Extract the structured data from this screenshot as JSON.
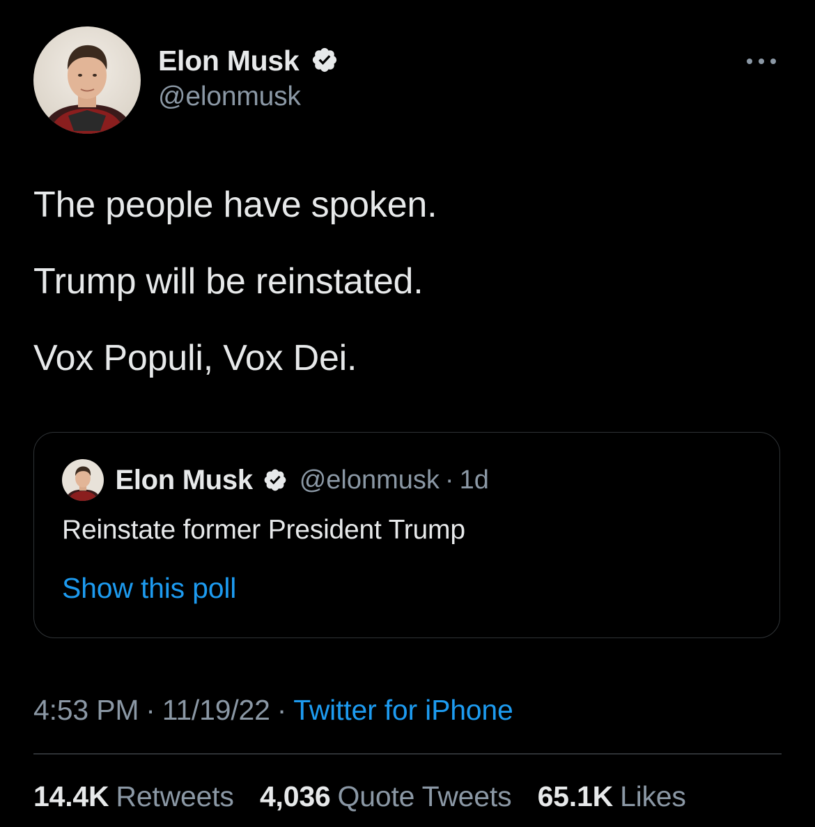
{
  "author": {
    "display_name": "Elon Musk",
    "handle": "@elonmusk",
    "verified": true
  },
  "tweet": {
    "lines": [
      "The people have spoken.",
      "Trump will be reinstated.",
      "Vox Populi, Vox Dei."
    ]
  },
  "quoted_tweet": {
    "display_name": "Elon Musk",
    "handle": "@elonmusk",
    "separator": "·",
    "age": "1d",
    "text": "Reinstate former President Trump",
    "poll_link": "Show this poll"
  },
  "meta": {
    "time": "4:53 PM",
    "separator": "·",
    "date": "11/19/22",
    "source": "Twitter for iPhone"
  },
  "stats": {
    "retweets_count": "14.4K",
    "retweets_label": "Retweets",
    "quotes_count": "4,036",
    "quotes_label": "Quote Tweets",
    "likes_count": "65.1K",
    "likes_label": "Likes"
  },
  "icons": {
    "verified": "verified-badge-icon",
    "more": "more-horizontal-icon"
  },
  "colors": {
    "background": "#000000",
    "primary_text": "#e7e9ea",
    "secondary_text": "#8b98a5",
    "accent": "#1d9bf0",
    "border": "#2f3336"
  }
}
